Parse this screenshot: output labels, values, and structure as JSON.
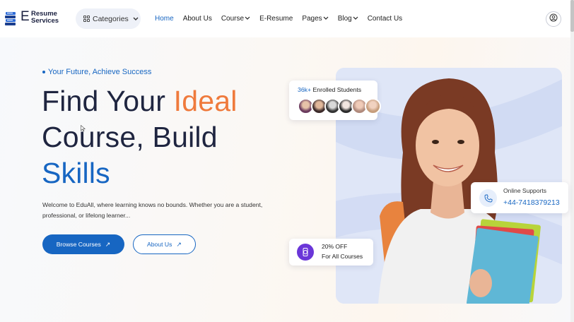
{
  "header": {
    "logo_letter": "E",
    "logo_line1": "Resume",
    "logo_line2": "Services",
    "categories_label": "Categories",
    "nav": [
      {
        "label": "Home",
        "active": true,
        "dropdown": false
      },
      {
        "label": "About Us",
        "active": false,
        "dropdown": false
      },
      {
        "label": "Course",
        "active": false,
        "dropdown": true
      },
      {
        "label": "E-Resume",
        "active": false,
        "dropdown": false
      },
      {
        "label": "Pages",
        "active": false,
        "dropdown": true
      },
      {
        "label": "Blog",
        "active": false,
        "dropdown": true
      },
      {
        "label": "Contact Us",
        "active": false,
        "dropdown": false
      }
    ]
  },
  "hero": {
    "tagline": "Your Future, Achieve Success",
    "headline_part1": "Find Your ",
    "headline_highlight": "Ideal",
    "headline_part2": "Course, Build",
    "headline_part3": "Skills",
    "description": "Welcome to EduAll, where learning knows no bounds. Whether you are a student, professional, or lifelong learner...",
    "browse_button": "Browse Courses",
    "about_button": "About Us",
    "arrow_glyph": "↗"
  },
  "cards": {
    "students_count": "36k+",
    "students_label": "Enrolled Students",
    "support_title": "Online Supports",
    "support_phone": "+44-7418379213",
    "discount_line1": "20% OFF",
    "discount_line2": "For All Courses"
  },
  "colors": {
    "accent_blue": "#1766c2",
    "accent_orange": "#ef7a3c",
    "discount_purple": "#6a36d8"
  }
}
